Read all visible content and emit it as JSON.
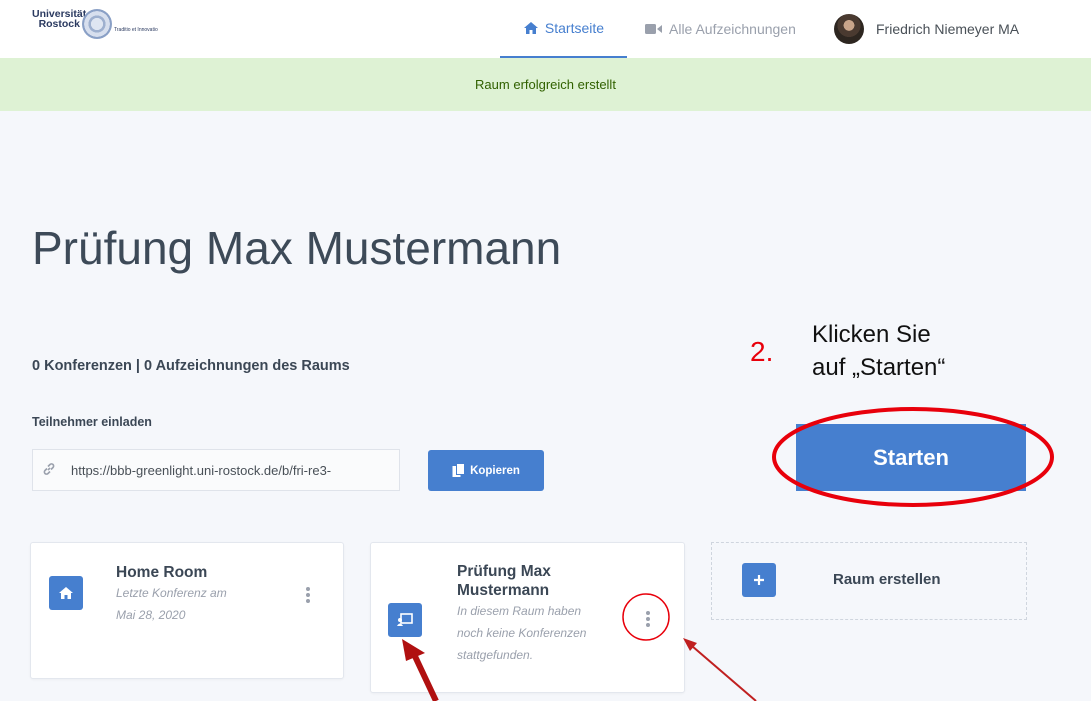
{
  "header": {
    "logo_line1": "Universität",
    "logo_line2": "Rostock",
    "logo_tagline": "Traditio et Innovatio",
    "nav_home": "Startseite",
    "nav_recordings": "Alle Aufzeichnungen",
    "user_name": "Friedrich Niemeyer MA"
  },
  "flash": {
    "message": "Raum erfolgreich erstellt"
  },
  "room": {
    "title": "Prüfung Max Mustermann",
    "stats": "0 Konferenzen | 0 Aufzeichnungen des Raums",
    "invite_label": "Teilnehmer einladen",
    "invite_url": "https://bbb-greenlight.uni-rostock.de/b/fri-re3-",
    "copy_label": "Kopieren",
    "start_label": "Starten"
  },
  "annotation": {
    "number": "2.",
    "line1": "Klicken Sie",
    "line2": "auf „Starten“"
  },
  "cards": {
    "home": {
      "title": "Home Room",
      "sub1": "Letzte Konferenz am",
      "sub2": "Mai 28, 2020",
      "icon": "home-icon"
    },
    "exam": {
      "title1": "Prüfung Max",
      "title2": "Mustermann",
      "sub1": "In diesem Raum haben",
      "sub2": "noch keine Konferenzen",
      "sub3": "stattgefunden.",
      "icon": "presentation-icon"
    },
    "create": {
      "label": "Raum erstellen",
      "icon": "plus-icon"
    }
  },
  "colors": {
    "accent": "#467fcf",
    "flash_bg": "#def2d4",
    "flash_text": "#316100",
    "annotation_red": "#e8000b",
    "arrow_red": "#b01010"
  }
}
